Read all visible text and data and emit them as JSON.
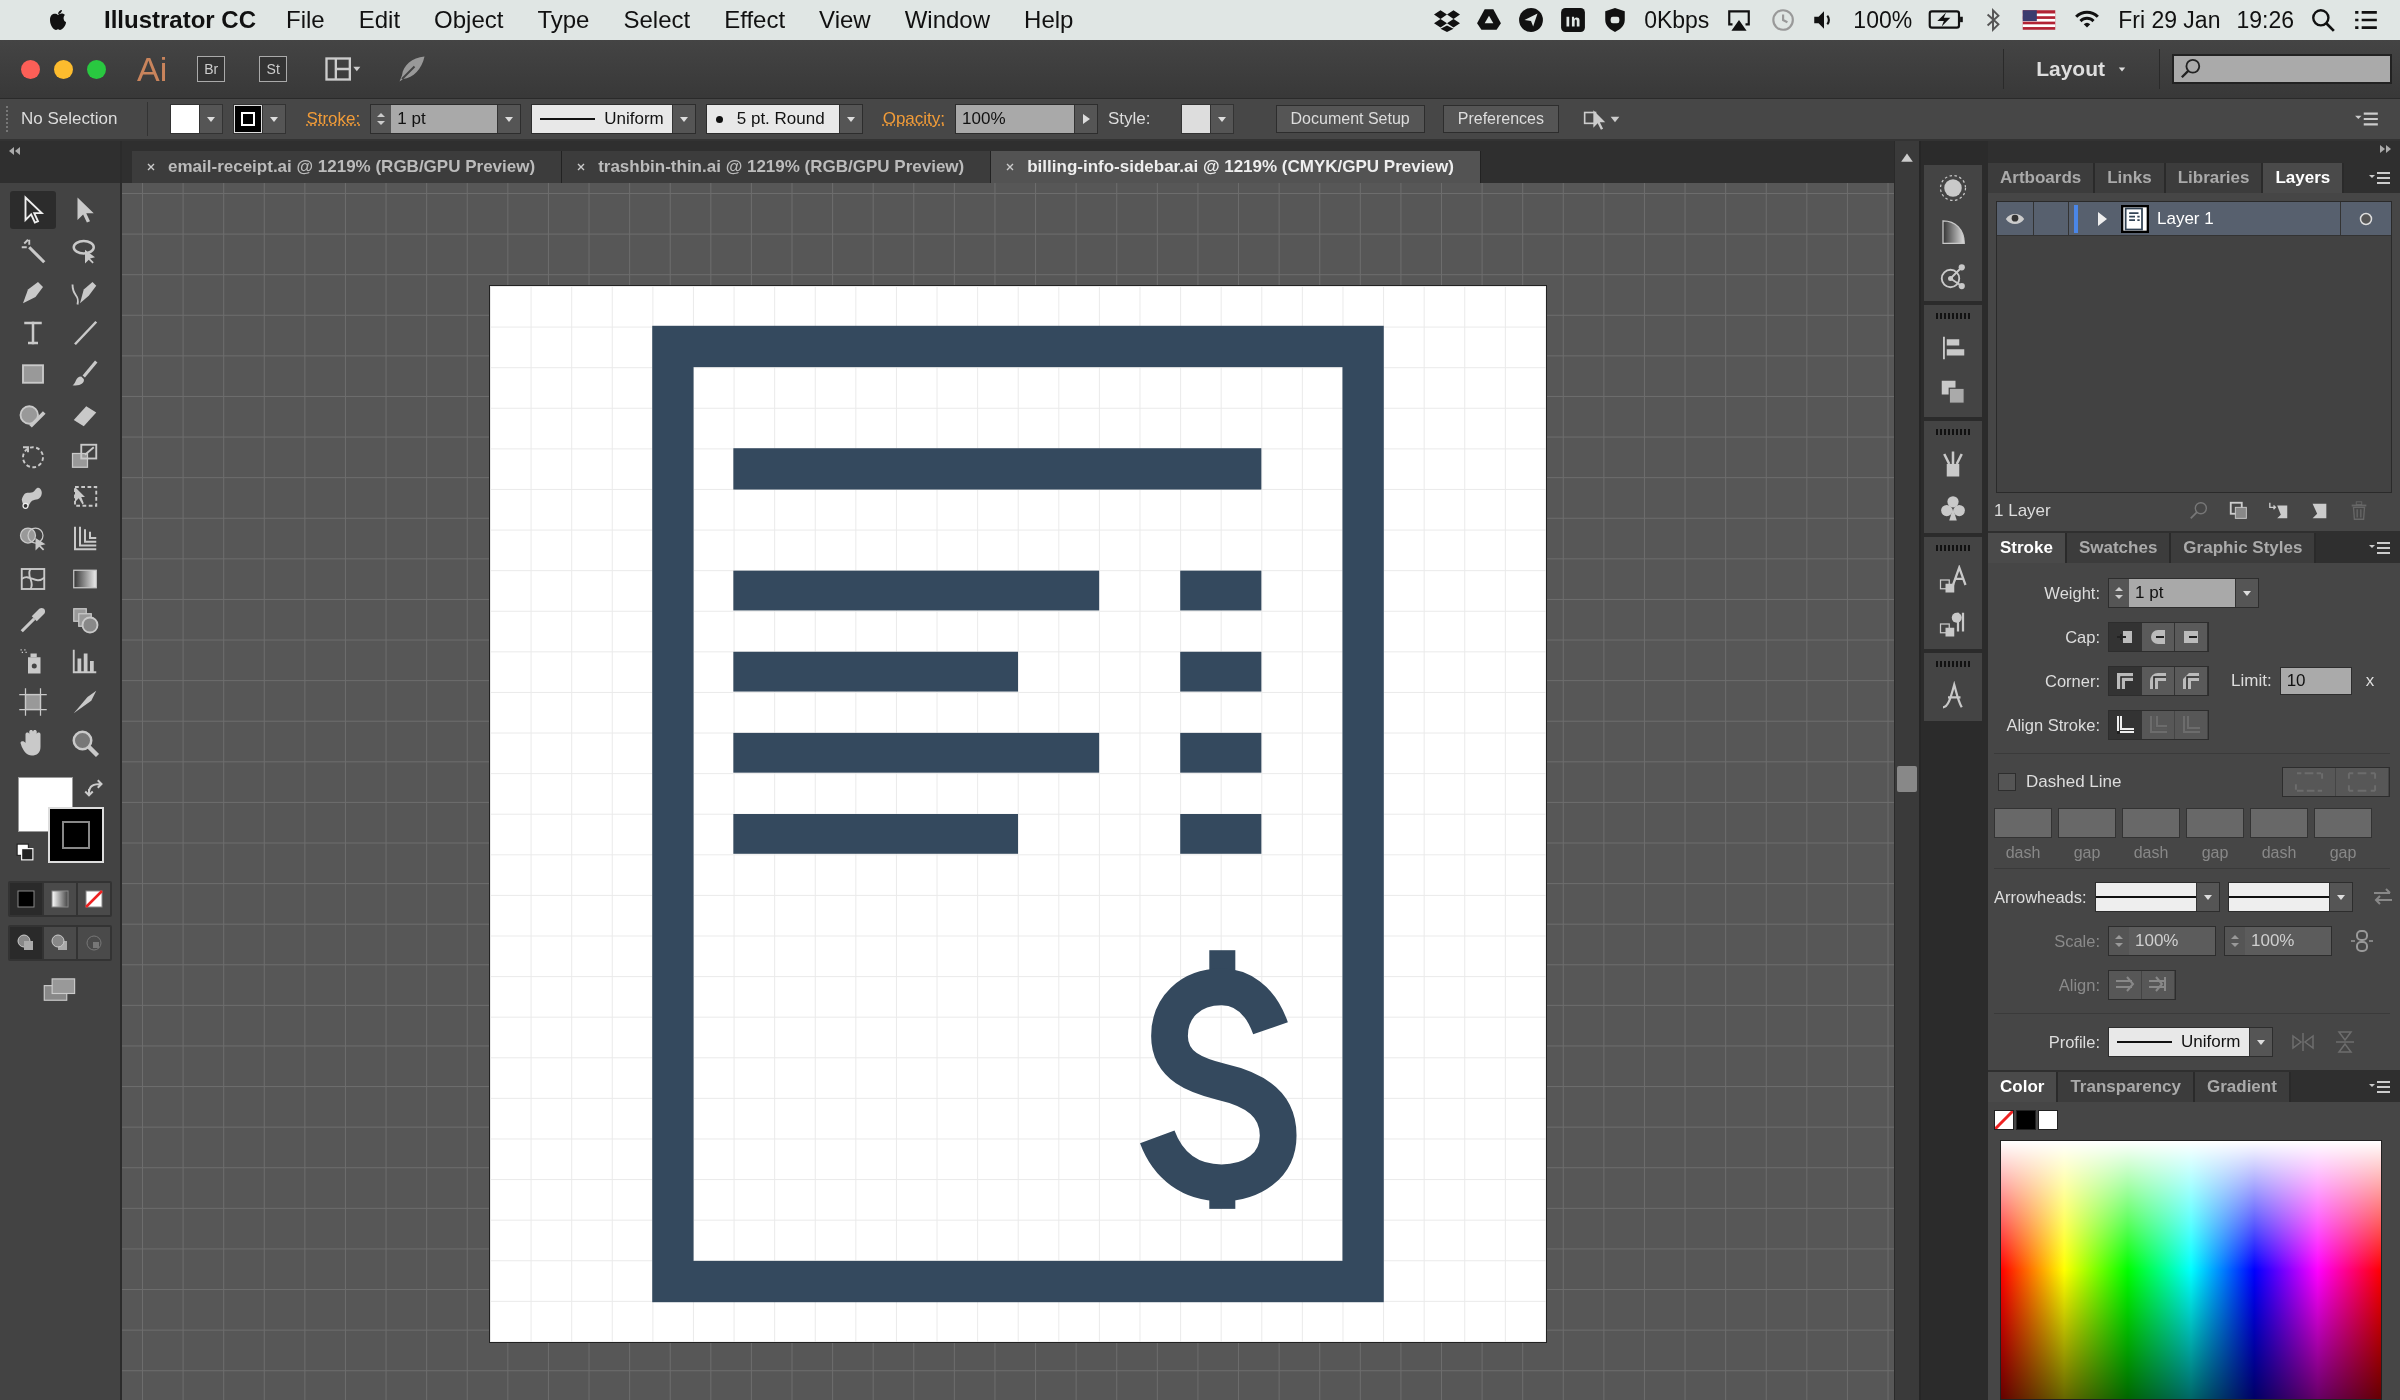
{
  "menu_bar": {
    "app_name": "Illustrator CC",
    "menus": [
      "File",
      "Edit",
      "Object",
      "Type",
      "Select",
      "Effect",
      "View",
      "Window",
      "Help"
    ],
    "network_speed": "0Kbps",
    "battery": "100%",
    "date": "Fri 29 Jan",
    "time": "19:26"
  },
  "app_bar": {
    "logo": "Ai",
    "bridge": "Br",
    "stock": "St",
    "workspace": "Layout"
  },
  "control_bar": {
    "selection": "No Selection",
    "stroke_label": "Stroke:",
    "stroke_weight": "1 pt",
    "variable_width": "Uniform",
    "brush": "5 pt. Round",
    "opacity_label": "Opacity:",
    "opacity": "100%",
    "style_label": "Style:",
    "buttons": [
      "Document Setup",
      "Preferences"
    ]
  },
  "document_tabs": [
    {
      "title": "email-receipt.ai @ 1219% (RGB/GPU Preview)",
      "selected": false
    },
    {
      "title": "trashbin-thin.ai @ 1219% (RGB/GPU Preview)",
      "selected": false
    },
    {
      "title": "billing-info-sidebar.ai @ 1219% (CMYK/GPU Preview)",
      "selected": true
    }
  ],
  "layers_panel": {
    "tabs": [
      {
        "label": "Artboards",
        "selected": false
      },
      {
        "label": "Links",
        "selected": false
      },
      {
        "label": "Libraries",
        "selected": false
      },
      {
        "label": "Layers",
        "selected": true
      }
    ],
    "layers": [
      {
        "name": "Layer 1",
        "visible": true,
        "expanded": false
      }
    ],
    "count": "1 Layer"
  },
  "stroke_panel": {
    "tabs": [
      {
        "label": "Stroke",
        "selected": true
      },
      {
        "label": "Swatches",
        "selected": false
      },
      {
        "label": "Graphic Styles",
        "selected": false
      }
    ],
    "weight_label": "Weight:",
    "weight": "1 pt",
    "cap_label": "Cap:",
    "caps": [
      {
        "selected": true
      },
      {
        "selected": false
      },
      {
        "selected": false
      }
    ],
    "corner_label": "Corner:",
    "corners": [
      {
        "selected": true
      },
      {
        "selected": false
      },
      {
        "selected": false
      }
    ],
    "limit_label": "Limit:",
    "limit": "10",
    "limit_unit": "x",
    "align_label": "Align Stroke:",
    "aligns": [
      {
        "selected": true,
        "disabled": false
      },
      {
        "selected": false,
        "disabled": true
      },
      {
        "selected": false,
        "disabled": true
      }
    ],
    "dashed_line": {
      "label": "Dashed Line",
      "checked": false
    },
    "dash_fields": [
      {
        "label": "dash"
      },
      {
        "label": "gap"
      },
      {
        "label": "dash"
      },
      {
        "label": "gap"
      },
      {
        "label": "dash"
      },
      {
        "label": "gap"
      }
    ],
    "arrowheads_label": "Arrowheads:",
    "scale_label": "Scale:",
    "scales": [
      "100%",
      "100%"
    ],
    "arrow_options_disabled": true,
    "arrow_align_label": "Align:",
    "profile_label": "Profile:",
    "profile": "Uniform"
  },
  "color_panel": {
    "tabs": [
      {
        "label": "Color",
        "selected": true
      },
      {
        "label": "Transparency",
        "selected": false
      },
      {
        "label": "Gradient",
        "selected": false
      }
    ]
  }
}
